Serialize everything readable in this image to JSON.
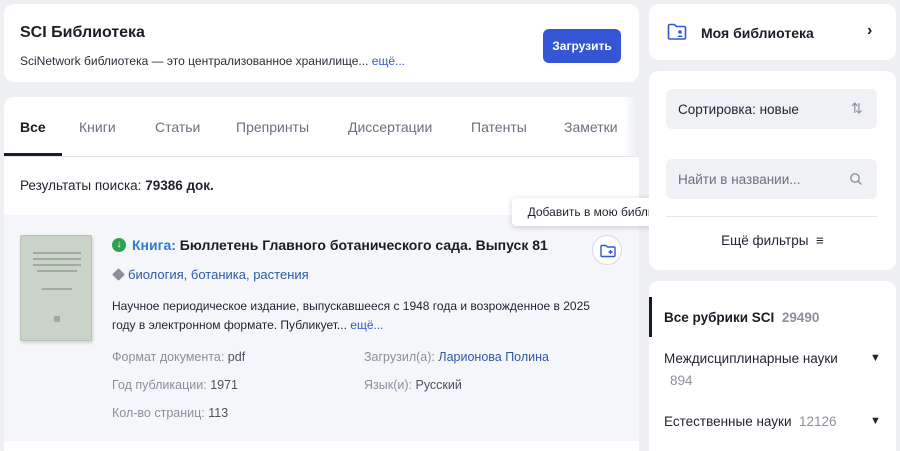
{
  "header": {
    "title": "SCI Библиотека",
    "description": "SciNetwork библиотека — это централизованное хранилище...",
    "more_link": "ещё...",
    "upload_button": "Загрузить"
  },
  "tabs": [
    {
      "label": "Все",
      "active": true
    },
    {
      "label": "Книги",
      "active": false
    },
    {
      "label": "Статьи",
      "active": false
    },
    {
      "label": "Препринты",
      "active": false
    },
    {
      "label": "Диссертации",
      "active": false
    },
    {
      "label": "Патенты",
      "active": false
    },
    {
      "label": "Заметки",
      "active": false
    }
  ],
  "results": {
    "prefix": "Результаты поиска:",
    "count": "79386 док."
  },
  "item": {
    "type_label": "Книга:",
    "title": "Бюллетень Главного ботанического сада. Выпуск 81",
    "tags": [
      "биология",
      "ботаника",
      "растения"
    ],
    "description": "Научное периодическое издание, выпускавшееся с 1948 года и возрожденное в 2025 году в электронном формате. Публикует...",
    "description_more": "ещё...",
    "format_label": "Формат документа:",
    "format_value": "pdf",
    "year_label": "Год публикации:",
    "year_value": "1971",
    "pages_label": "Кол-во страниц:",
    "pages_value": "113",
    "uploader_label": "Загрузил(а):",
    "uploader_value": "Ларионова Полина",
    "language_label": "Язык(и):",
    "language_value": "Русский",
    "tooltip": "Добавить в мою библиотеку"
  },
  "sidebar": {
    "my_library": "Моя библиотека",
    "sort_label": "Сортировка: новые",
    "search_placeholder": "Найти в названии...",
    "more_filters": "Ещё фильтры",
    "rubrics": [
      {
        "label": "Все рубрики SCI",
        "count": "29490"
      },
      {
        "label": "Междисциплинарные науки",
        "count": "894"
      },
      {
        "label": "Естественные науки",
        "count": "12126"
      }
    ]
  },
  "colors": {
    "accent": "#3556d4",
    "link": "#2e5aa8",
    "success": "#2fa24f",
    "background": "#edeff3"
  }
}
